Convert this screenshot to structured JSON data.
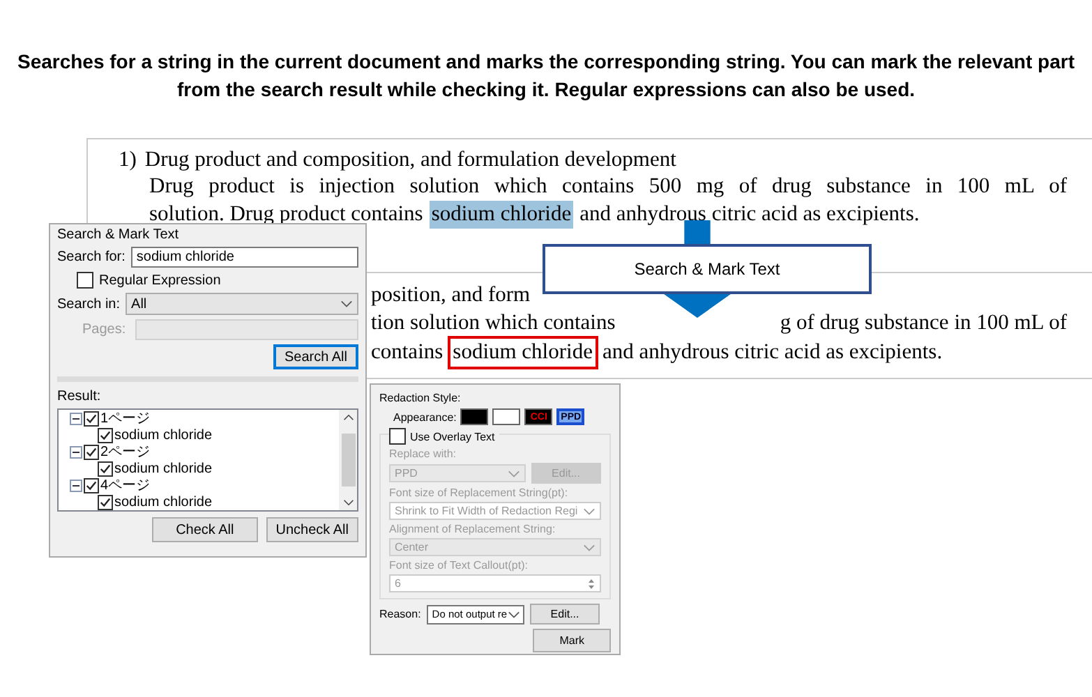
{
  "caption": "Searches for a string in the current document and marks the corresponding string. You can mark the relevant part from the search result while checking it. Regular expressions can also be used.",
  "document_before": {
    "number": "1)",
    "heading": "Drug product and composition, and formulation development",
    "lines": [
      [
        {
          "kind": "plain",
          "text": "Drug product is injection solution which contains 500 mg of drug substance in 100 mL of"
        }
      ],
      [
        {
          "kind": "plain",
          "text": "solution. Drug product contains"
        },
        {
          "kind": "highlight",
          "text": "sodium chloride"
        },
        {
          "kind": "plain",
          "text": "and anhydrous citric acid as excipients."
        }
      ]
    ]
  },
  "callout": "Search & Mark Text",
  "document_after": {
    "lines": [
      [
        {
          "kind": "plain",
          "text": "position, and form"
        }
      ],
      [
        {
          "kind": "plain",
          "text": "tion solution which contains"
        },
        {
          "kind": "gap"
        },
        {
          "kind": "plain",
          "text": "g of drug substance in 100 mL of"
        }
      ],
      [
        {
          "kind": "plain",
          "text": "contains"
        },
        {
          "kind": "boxed",
          "text": "sodium chloride"
        },
        {
          "kind": "plain",
          "text": "and anhydrous citric acid as excipients."
        }
      ]
    ]
  },
  "search_dialog": {
    "title": "Search & Mark Text",
    "search_for_label": "Search for:",
    "search_for_value": "sodium chloride",
    "regular_expression": {
      "label": "Regular Expression",
      "checked": false
    },
    "search_in_label": "Search in:",
    "search_in_value": "All",
    "pages_label": "Pages:",
    "pages_disabled": true,
    "search_all": "Search All",
    "result_label": "Result:",
    "results": [
      {
        "label": "1ページ",
        "checked": true,
        "expanded": true,
        "children": [
          {
            "label": "sodium chloride",
            "checked": true
          }
        ]
      },
      {
        "label": "2ページ",
        "checked": true,
        "expanded": true,
        "children": [
          {
            "label": "sodium chloride",
            "checked": true
          }
        ]
      },
      {
        "label": "4ページ",
        "checked": true,
        "expanded": true,
        "children": [
          {
            "label": "sodium chloride",
            "checked": true
          }
        ]
      }
    ],
    "check_all": "Check All",
    "uncheck_all": "Uncheck All"
  },
  "redaction_panel": {
    "title": "Redaction Style:",
    "appearance_label": "Appearance:",
    "swatches": [
      {
        "kind": "black",
        "selected": false
      },
      {
        "kind": "white",
        "selected": false
      },
      {
        "kind": "text",
        "label": "CCI",
        "selected": false
      },
      {
        "kind": "text",
        "label": "PPD",
        "selected": true
      }
    ],
    "overlay": {
      "label": "Use Overlay Text",
      "checked": false
    },
    "replace_with_label": "Replace with:",
    "replace_with_value": "PPD",
    "replace_edit": "Edit...",
    "font_size_label": "Font size of Replacement String(pt):",
    "font_size_value": "Shrink to Fit Width of Redaction Regi",
    "alignment_label": "Alignment of Replacement String:",
    "alignment_value": "Center",
    "callout_size_label": "Font size of Text Callout(pt):",
    "callout_size_value": "6",
    "reason_label": "Reason:",
    "reason_value": "Do not output re",
    "reason_edit": "Edit...",
    "mark": "Mark"
  }
}
